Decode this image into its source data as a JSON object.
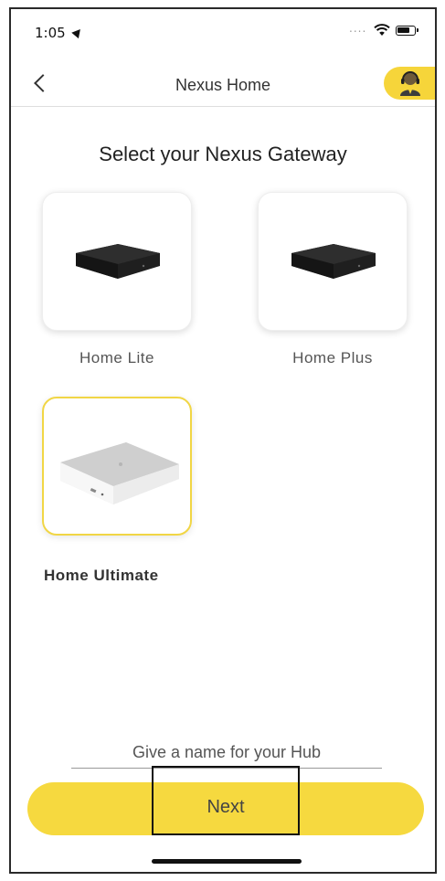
{
  "status_bar": {
    "time": "1:05",
    "location_icon": "location-arrow-icon",
    "signal": "....",
    "wifi_icon": "wifi-icon",
    "battery_icon": "battery-icon"
  },
  "nav": {
    "title": "Nexus Home",
    "back_icon": "chevron-left-icon",
    "support_icon": "support-agent-icon"
  },
  "heading": "Select your Nexus Gateway",
  "gateways": [
    {
      "label": "Home Lite",
      "selected": false
    },
    {
      "label": "Home Plus",
      "selected": false
    },
    {
      "label": "Home Ultimate",
      "selected": true
    }
  ],
  "hub_name": {
    "value": "",
    "placeholder": "Give a name for your Hub"
  },
  "next_button": {
    "label": "Next"
  },
  "colors": {
    "accent": "#f6d93f",
    "selected_border": "#f1d645",
    "text": "#333333"
  }
}
